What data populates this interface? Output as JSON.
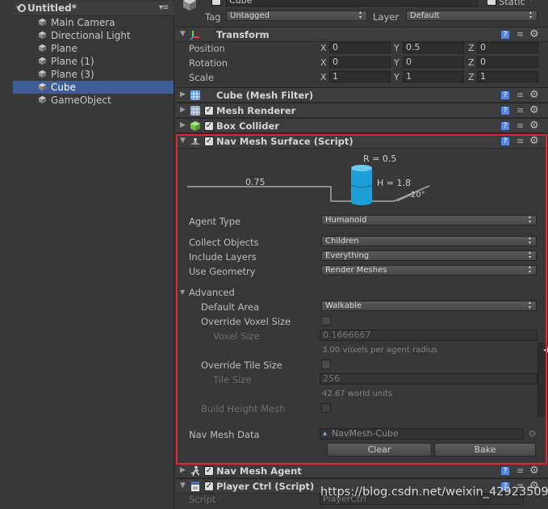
{
  "hierarchy": {
    "scene_name": "Untitled*",
    "items": [
      {
        "label": "Main Camera"
      },
      {
        "label": "Directional Light"
      },
      {
        "label": "Plane"
      },
      {
        "label": "Plane (1)"
      },
      {
        "label": "Plane (3)"
      },
      {
        "label": "Cube"
      },
      {
        "label": "GameObject"
      }
    ],
    "selected": "Cube",
    "selection_color": "#3e5f96"
  },
  "object_header": {
    "name": "Cube",
    "static_label": "Static",
    "tag_label": "Tag",
    "tag_value": "Untagged",
    "layer_label": "Layer",
    "layer_value": "Default"
  },
  "transform": {
    "title": "Transform",
    "position_label": "Position",
    "rotation_label": "Rotation",
    "scale_label": "Scale",
    "axis_x": "X",
    "axis_y": "Y",
    "axis_z": "Z",
    "position": {
      "x": "0",
      "y": "0.5",
      "z": "0"
    },
    "rotation": {
      "x": "0",
      "y": "0",
      "z": "0"
    },
    "scale": {
      "x": "1",
      "y": "1",
      "z": "1"
    }
  },
  "components": {
    "mesh_filter": "Cube (Mesh Filter)",
    "mesh_renderer": "Mesh Renderer",
    "box_collider": "Box Collider",
    "nav_mesh_surface": "Nav Mesh Surface (Script)",
    "nav_mesh_agent": "Nav Mesh Agent",
    "player_ctrl": "Player Ctrl (Script)"
  },
  "agent_diagram": {
    "radius_label": "R = 0.5",
    "height_label": "H = 1.8",
    "step_label": "0.75",
    "slope_label": "20°"
  },
  "nav_mesh_surface": {
    "agent_type_label": "Agent Type",
    "agent_type_value": "Humanoid",
    "collect_objects_label": "Collect Objects",
    "collect_objects_value": "Children",
    "include_layers_label": "Include Layers",
    "include_layers_value": "Everything",
    "use_geometry_label": "Use Geometry",
    "use_geometry_value": "Render Meshes",
    "advanced_label": "Advanced",
    "default_area_label": "Default Area",
    "default_area_value": "Walkable",
    "override_voxel_label": "Override Voxel Size",
    "voxel_size_label": "Voxel Size",
    "voxel_size_value": "0.1666667",
    "voxel_hint": "3.00 voxels per agent radius",
    "override_tile_label": "Override Tile Size",
    "tile_size_label": "Tile Size",
    "tile_size_value": "256",
    "tile_hint": "42.67 world units",
    "build_height_label": "Build Height Mesh",
    "nav_mesh_data_label": "Nav Mesh Data",
    "nav_mesh_data_value": "NavMesh-Cube",
    "clear_button": "Clear",
    "bake_button": "Bake"
  },
  "player_ctrl": {
    "script_label": "Script",
    "script_value": "PlayerCtrl"
  },
  "watermark": "https://blog.csdn.net/weixin_42923509",
  "colors": {
    "highlight_box": "#e0262f",
    "agent_cylinder": "#1e9fd8",
    "help_icon": "#5a88d8"
  }
}
